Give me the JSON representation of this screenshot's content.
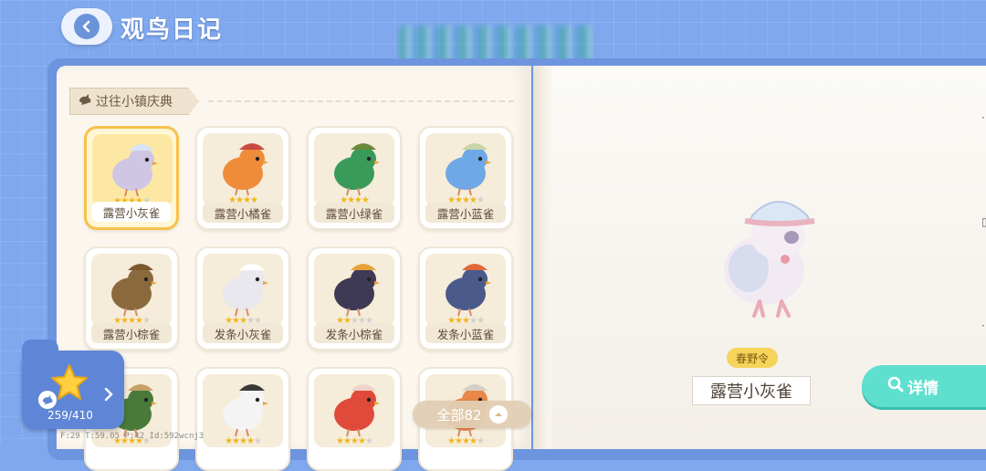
{
  "header": {
    "title": "观鸟日记",
    "back_icon": "back-arrow-icon"
  },
  "section": {
    "label": "过往小镇庆典",
    "icon": "bird-icon"
  },
  "birds": [
    {
      "name": "露营小灰雀",
      "stars": 4,
      "max_stars": 5,
      "selected": true
    },
    {
      "name": "露营小橘雀",
      "stars": 4,
      "max_stars": 4,
      "selected": false
    },
    {
      "name": "露营小绿雀",
      "stars": 4,
      "max_stars": 4,
      "selected": false
    },
    {
      "name": "露营小蓝雀",
      "stars": 4,
      "max_stars": 5,
      "selected": false
    },
    {
      "name": "露营小棕雀",
      "stars": 4,
      "max_stars": 5,
      "selected": false
    },
    {
      "name": "发条小灰雀",
      "stars": 3,
      "max_stars": 5,
      "selected": false
    },
    {
      "name": "发条小棕雀",
      "stars": 2,
      "max_stars": 5,
      "selected": false
    },
    {
      "name": "发条小蓝雀",
      "stars": 3,
      "max_stars": 5,
      "selected": false
    },
    {
      "name": "",
      "stars": 4,
      "max_stars": 5,
      "selected": false
    },
    {
      "name": "",
      "stars": 4,
      "max_stars": 5,
      "selected": false
    },
    {
      "name": "",
      "stars": 4,
      "max_stars": 5,
      "selected": false
    },
    {
      "name": "",
      "stars": 4,
      "max_stars": 5,
      "selected": false
    }
  ],
  "filter": {
    "label": "全部82",
    "icon": "chevron-up-icon"
  },
  "progress": {
    "text": "259/410",
    "icon": "star-icon",
    "chevron": "chevron-right-icon"
  },
  "debug": {
    "text": "F:29  T:59.05  P:42  Id:592wcnj3"
  },
  "preview": {
    "tag": "春野令",
    "name": "露营小灰雀"
  },
  "details_button": {
    "label": "详情",
    "icon": "search-icon"
  },
  "colors": {
    "background": "#7fa8ee",
    "accent_teal": "#5fe0cf",
    "selected_gold": "#f7c24a",
    "star": "#f2b51c"
  }
}
